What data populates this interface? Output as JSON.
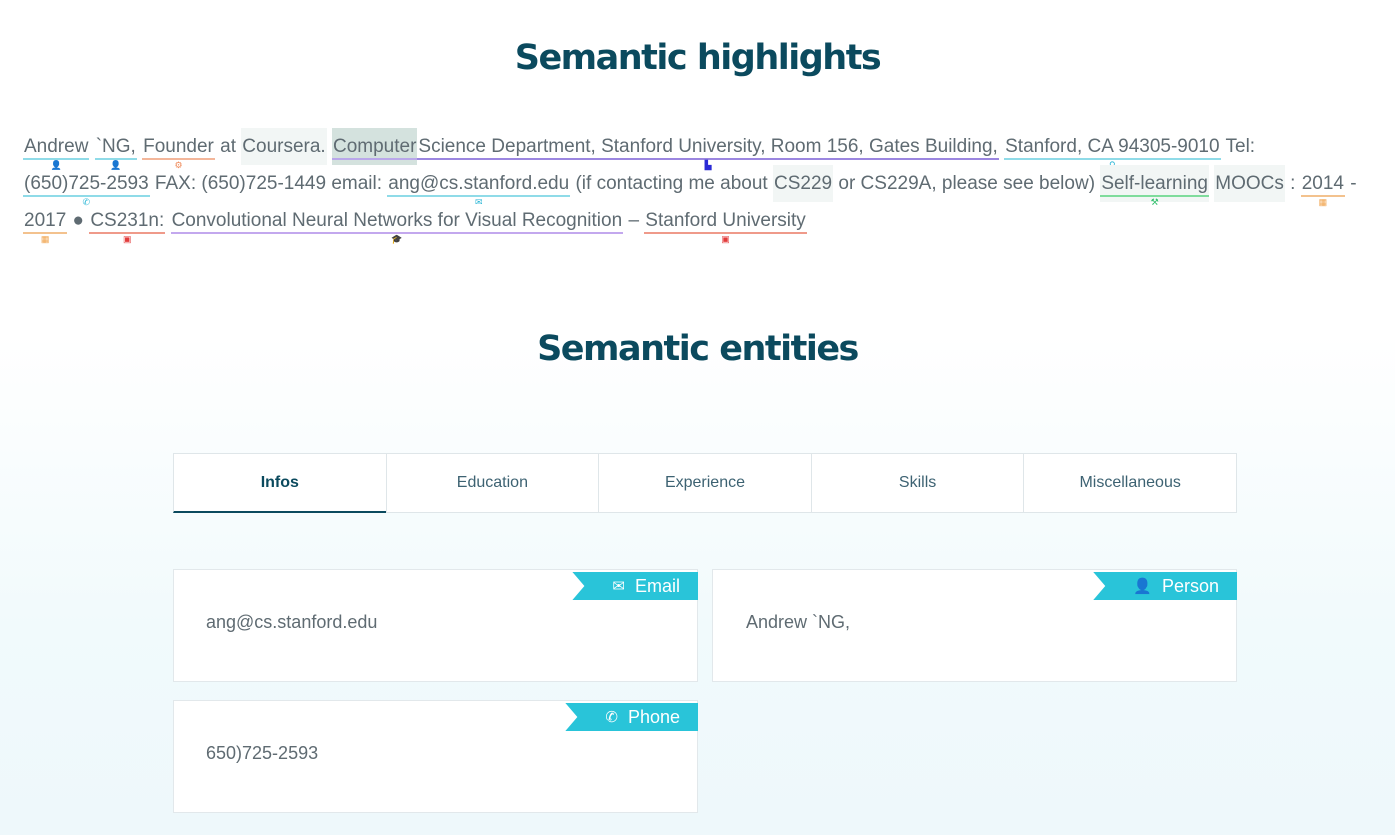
{
  "highlights_title": "Semantic highlights",
  "entities_title": "Semantic entities",
  "highlight_tokens": [
    {
      "text": "Andrew",
      "ul": "#8fdbe8",
      "icon": "person-icon",
      "glyph": "👤",
      "color": "#29b6d6"
    },
    {
      "text": " "
    },
    {
      "text": "`NG,",
      "ul": "#8fdbe8",
      "icon": "person-icon",
      "glyph": "👤",
      "color": "#29b6d6"
    },
    {
      "text": " "
    },
    {
      "text": "Founder",
      "ul": "#f3b69a",
      "icon": "job-icon",
      "glyph": "⚙",
      "color": "#ef8a5a"
    },
    {
      "text": " at "
    },
    {
      "text": "Coursera.",
      "bg": "light"
    },
    {
      "text": " "
    },
    {
      "text": "Computer",
      "bg": "shade",
      "ul": "#b9a7ea"
    },
    {
      "text": " Science Department, Stanford University, Room 156, Gates Building,",
      "ul": "#9b86e0",
      "icon": "organization-icon",
      "glyph": "▙",
      "color": "#2b2bd6"
    },
    {
      "text": " "
    },
    {
      "text": "Stanford, CA 94305-9010",
      "ul": "#8fdbe8",
      "icon": "location-icon",
      "glyph": "⚲",
      "color": "#29b6d6"
    },
    {
      "text": " Tel: "
    },
    {
      "text": "(650)725-2593",
      "ul": "#8fdbe8",
      "icon": "phone-icon",
      "glyph": "✆",
      "color": "#29b6d6"
    },
    {
      "text": " FAX: (650)725-1449 email: "
    },
    {
      "text": "ang@cs.stanford.edu",
      "ul": "#8fdbe8",
      "icon": "email-icon",
      "glyph": "✉",
      "color": "#29b6d6"
    },
    {
      "text": " (if contacting me about "
    },
    {
      "text": "CS229",
      "bg": "light"
    },
    {
      "text": " or CS229A, please see below) "
    },
    {
      "text": "Self-learning",
      "bg": "light",
      "ul": "#7fdc9c",
      "icon": "skill-icon",
      "glyph": "⚒",
      "color": "#2fbf6a"
    },
    {
      "text": " "
    },
    {
      "text": "MOOCs",
      "bg": "light"
    },
    {
      "text": " : "
    },
    {
      "text": "2014",
      "ul": "#f3c28e",
      "icon": "calendar-icon",
      "glyph": "▦",
      "color": "#f0a24a"
    },
    {
      "text": " - "
    },
    {
      "text": "2017",
      "ul": "#f3c28e",
      "icon": "calendar-icon",
      "glyph": "▦",
      "color": "#f0a24a"
    },
    {
      "text": " ● "
    },
    {
      "text": "CS231n:",
      "ul": "#ef9a8a",
      "icon": "course-icon",
      "glyph": "▣",
      "color": "#e23b3b"
    },
    {
      "text": " "
    },
    {
      "text": "Convolutional Neural Networks for Visual Recognition",
      "ul": "#c3a8ee",
      "icon": "degree-icon",
      "glyph": "🎓",
      "color": "#9b5be0"
    },
    {
      "text": " – "
    },
    {
      "text": "Stanford University",
      "ul": "#ef9a8a",
      "icon": "school-icon",
      "glyph": "▣",
      "color": "#e23b3b"
    }
  ],
  "tabs": [
    {
      "label": "Infos",
      "active": true
    },
    {
      "label": "Education",
      "active": false
    },
    {
      "label": "Experience",
      "active": false
    },
    {
      "label": "Skills",
      "active": false
    },
    {
      "label": "Miscellaneous",
      "active": false
    }
  ],
  "cards": {
    "email": {
      "badge": "Email",
      "icon": "email-icon",
      "value": "ang@cs.stanford.edu"
    },
    "person": {
      "badge": "Person",
      "icon": "person-icon",
      "value": "Andrew `NG,"
    },
    "phone": {
      "badge": "Phone",
      "icon": "phone-icon",
      "value": "650)725-2593"
    }
  },
  "colors": {
    "title": "#0b4a5e",
    "badge": "#29c4d9",
    "highlight_shade": "#d4e2de"
  }
}
